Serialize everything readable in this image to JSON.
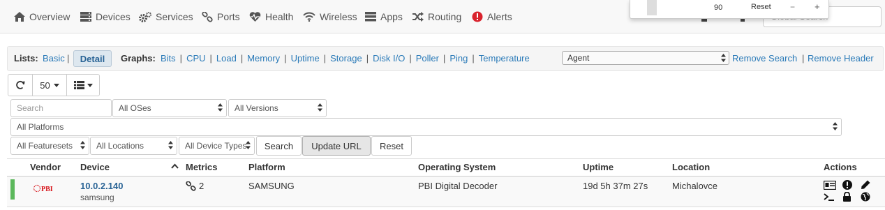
{
  "nav": {
    "items": [
      {
        "label": "Overview",
        "icon": "home-icon"
      },
      {
        "label": "Devices",
        "icon": "server-icon"
      },
      {
        "label": "Services",
        "icon": "cogs-icon"
      },
      {
        "label": "Ports",
        "icon": "link-icon"
      },
      {
        "label": "Health",
        "icon": "heartbeat-icon"
      },
      {
        "label": "Wireless",
        "icon": "wifi-icon"
      },
      {
        "label": "Apps",
        "icon": "tasks-icon"
      },
      {
        "label": "Routing",
        "icon": "random-icon"
      },
      {
        "label": "Alerts",
        "icon": "alert-circle-icon"
      }
    ],
    "global_search_placeholder": "Global Search"
  },
  "popup": {
    "value": "90",
    "reset": "Reset",
    "minus": "−",
    "plus": "+"
  },
  "lists": {
    "label": "Lists:",
    "basic": "Basic",
    "detail": "Detail",
    "graphs_label": "Graphs:",
    "graphs": [
      "Bits",
      "CPU",
      "Load",
      "Memory",
      "Uptime",
      "Storage",
      "Disk I/O",
      "Poller",
      "Ping",
      "Temperature"
    ],
    "agent_selected": "Agent",
    "remove_search": "Remove Search",
    "remove_header": "Remove Header"
  },
  "toolbar": {
    "page_size": "50"
  },
  "filters": {
    "search_placeholder": "Search",
    "os": "All OSes",
    "versions": "All Versions",
    "platforms": "All Platforms",
    "featuresets": "All Featuresets",
    "locations": "All Locations",
    "device_types": "All Device Types",
    "search_button": "Search",
    "update_url_button": "Update URL",
    "reset_button": "Reset"
  },
  "table": {
    "columns": [
      "Vendor",
      "Device",
      "Metrics",
      "Platform",
      "Operating System",
      "Uptime",
      "Location",
      "Actions"
    ],
    "rows": [
      {
        "status_color": "#5cb85c",
        "vendor_logo": "PBI",
        "device": "10.0.2.140",
        "hostname": "samsung",
        "metrics": "2",
        "platform": "SAMSUNG",
        "os": "PBI Digital Decoder",
        "uptime": "19d 5h 37m 27s",
        "location": "Michalovce"
      }
    ]
  },
  "colors": {
    "link": "#2a7ab8",
    "status_up": "#5cb85c",
    "alert_red": "#d9232d",
    "vendor_red": "#d7141a"
  }
}
